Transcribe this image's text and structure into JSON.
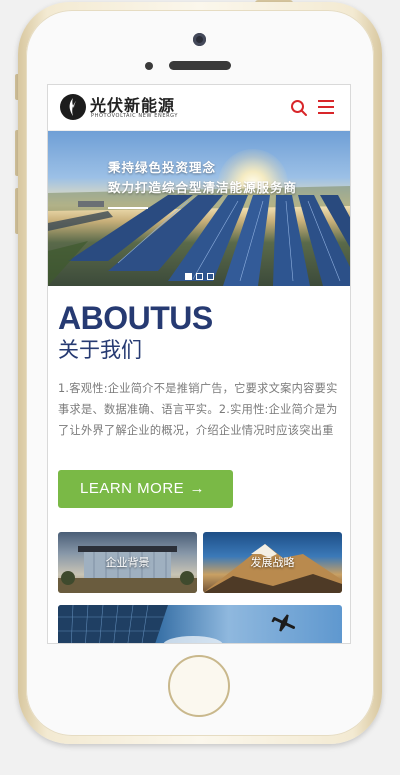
{
  "header": {
    "logo_title": "光伏新能源",
    "logo_subtitle": "PHOTOVOLTAIC NEW ENERGY"
  },
  "banner": {
    "line1": "秉持绿色投资理念",
    "line2": "致力打造综合型清洁能源服务商",
    "slides": 3,
    "active_slide": 1
  },
  "about": {
    "title_en": "ABOUTUS",
    "title_cn": "关于我们",
    "description": "1.客观性:企业简介不是推销广告，它要求文案内容要实事求是、数据准确、语言平实。2.实用性:企业简介是为了让外界了解企业的概况，介绍企业情况时应该突出重点、简洁明了，便于...",
    "button_label": "LEARN MORE",
    "button_arrow": "→"
  },
  "tiles": [
    {
      "label": "企业背景"
    },
    {
      "label": "发展战略"
    },
    {
      "label": ""
    }
  ],
  "colors": {
    "brand_blue": "#263a72",
    "button_green": "#7ab946",
    "icon_red": "#d8262a"
  }
}
